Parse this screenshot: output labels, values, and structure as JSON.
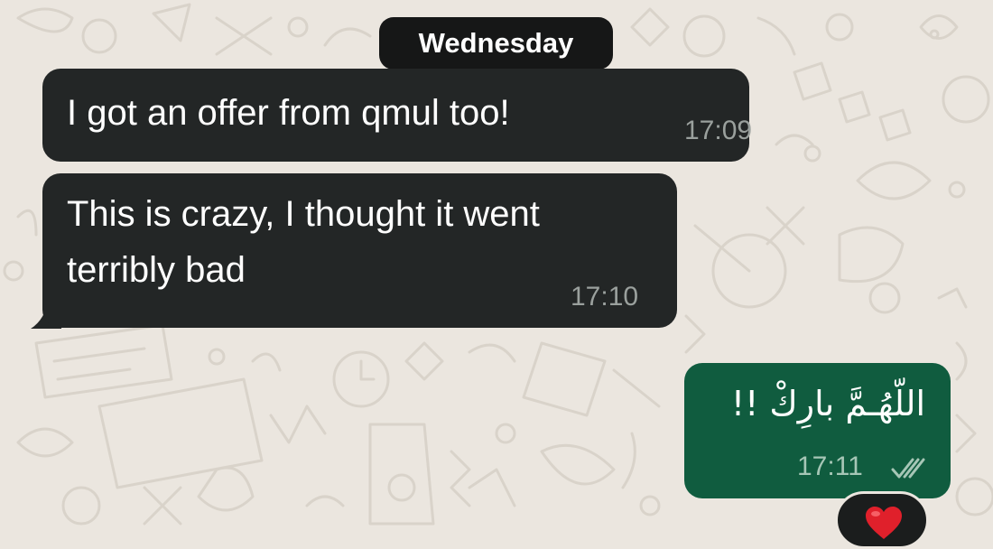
{
  "chat": {
    "date_separator": "Wednesday",
    "messages": [
      {
        "direction": "incoming",
        "text": "I got an offer from qmul too!",
        "time": "17:09"
      },
      {
        "direction": "incoming",
        "text_lines": [
          "This is crazy, I thought it went",
          "terribly bad"
        ],
        "time": "17:10"
      },
      {
        "direction": "outgoing",
        "text": "اللّهُـمَّ بارِكْ !!",
        "time": "17:11",
        "status": "read",
        "status_icon": "double-check-icon",
        "reaction": "heart-icon"
      }
    ]
  },
  "colors": {
    "wallpaper": "#ebe6df",
    "incoming_bubble": "#232626",
    "outgoing_bubble": "#105c3f",
    "date_pill": "#161717",
    "reaction_heart": "#e0202b"
  }
}
